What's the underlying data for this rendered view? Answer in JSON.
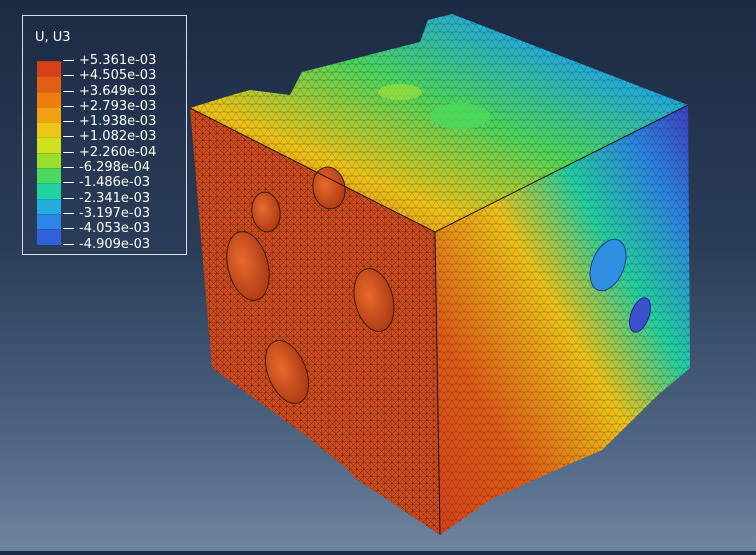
{
  "legend": {
    "title": "U, U3",
    "labels": [
      "+5.361e-03",
      "+4.505e-03",
      "+3.649e-03",
      "+2.793e-03",
      "+1.938e-03",
      "+1.082e-03",
      "+2.260e-04",
      "-6.298e-04",
      "-1.486e-03",
      "-2.341e-03",
      "-3.197e-03",
      "-4.053e-03",
      "-4.909e-03"
    ],
    "colors": [
      "#d8401a",
      "#e35d15",
      "#ef7e10",
      "#f3a012",
      "#f1c516",
      "#cfe01c",
      "#97e02c",
      "#4cd95c",
      "#22d3a2",
      "#22aedb",
      "#2b86e6",
      "#3061d8",
      "#3c3fc6"
    ]
  },
  "model": {
    "front_face_color": "#cf4a1e",
    "hole_color": "#c9461c",
    "mesh_line_color": "#3b1a0c",
    "top_gradient": [
      "#d8401a",
      "#f1c516",
      "#4cd95c",
      "#22aedb",
      "#3c3fc6"
    ],
    "right_gradient": [
      "#d8401a",
      "#e35d15",
      "#f1c516",
      "#22d3a2",
      "#2b86e6",
      "#3c3fc6"
    ]
  }
}
